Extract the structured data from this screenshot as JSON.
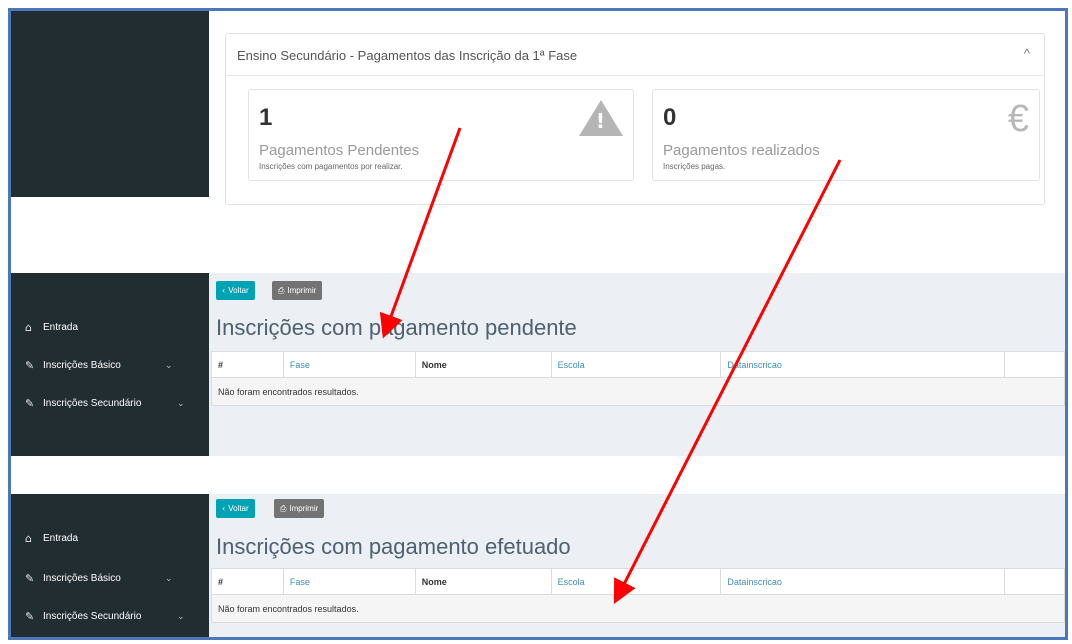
{
  "summary": {
    "panel_title": "Ensino Secundário - Pagamentos das Inscrição da 1ª Fase",
    "collapse_icon": "^",
    "cards": [
      {
        "count": "1",
        "label": "Pagamentos Pendentes",
        "sub": "Inscrições com pagamentos por realizar.",
        "icon": "warning-icon"
      },
      {
        "count": "0",
        "label": "Pagamentos realizados",
        "sub": "Inscrições pagas.",
        "icon": "euro-icon",
        "icon_glyph": "€"
      }
    ]
  },
  "sidebar": {
    "items": [
      {
        "label": "Entrada",
        "icon": "home-icon"
      },
      {
        "label": "Inscrições Básico",
        "icon": "edit-icon"
      },
      {
        "label": "Inscrições Secundário",
        "icon": "edit-icon"
      }
    ]
  },
  "toolbar": {
    "back_label": "Voltar",
    "print_label": "Imprimir"
  },
  "pending": {
    "title": "Inscrições com pagamento pendente",
    "columns": [
      "#",
      "Fase",
      "Nome",
      "Escola",
      "Datainscricao",
      ""
    ],
    "empty_message": "Não foram encontrados resultados."
  },
  "paid": {
    "title": "Inscrições com pagamento efetuado",
    "columns": [
      "#",
      "Fase",
      "Nome",
      "Escola",
      "Datainscricao",
      ""
    ],
    "empty_message": "Não foram encontrados resultados."
  },
  "colors": {
    "sidebar": "#222d32",
    "accent": "#00a3b4",
    "arrow": "#ff0000",
    "border": "#4a78b8"
  }
}
